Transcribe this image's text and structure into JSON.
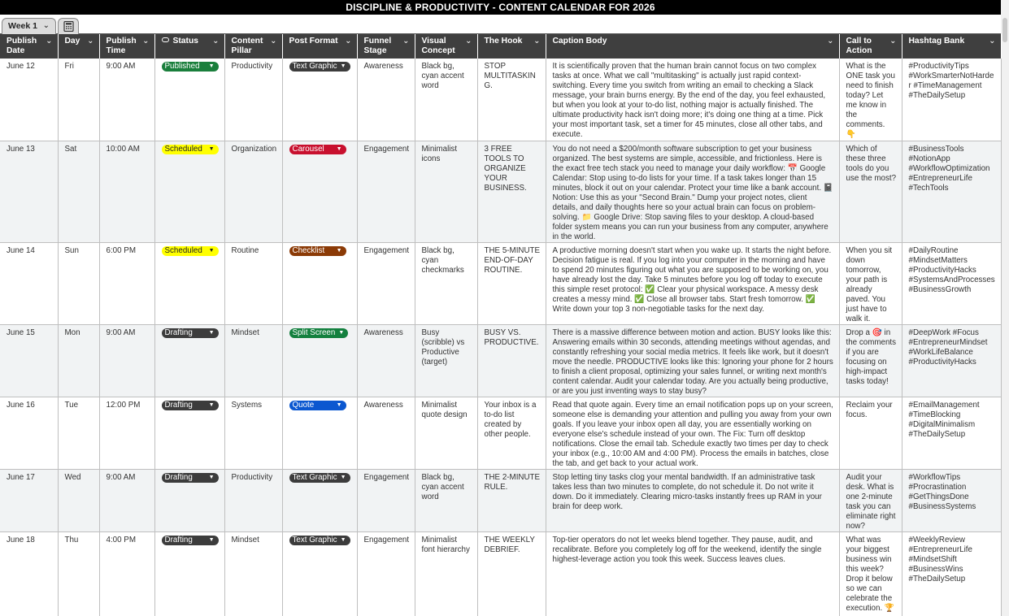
{
  "banner_title": "DISCIPLINE & PRODUCTIVITY - CONTENT CALENDAR FOR 2026",
  "tab": {
    "label": "Week 1",
    "icon": "calculator-icon"
  },
  "colors": {
    "published": "#1a7f3c",
    "scheduled": "#ffff00",
    "drafting": "#3c3c3c",
    "text_graphic": "#3c3c3c",
    "carousel": "#c8102e",
    "checklist": "#8b3a06",
    "split_screen": "#13803e",
    "quote": "#0b57d0",
    "header": "#3f3f3f"
  },
  "columns": {
    "publish_date": "Publish Date",
    "day": "Day",
    "publish_time": "Publish Time",
    "status": "Status",
    "content_pillar": "Content Pillar",
    "post_format": "Post Format",
    "funnel_stage": "Funnel Stage",
    "visual_concept": "Visual Concept",
    "hook": "The Hook",
    "caption": "Caption Body",
    "cta": "Call to Action",
    "hashtags": "Hashtag Bank"
  },
  "rows": [
    {
      "date": "June 12",
      "day": "Fri",
      "time": "9:00 AM",
      "status": "Published",
      "pillar": "Productivity",
      "format": "Text Graphic",
      "funnel": "Awareness",
      "visual": "Black bg, cyan accent word",
      "hook": "STOP MULTITASKING.",
      "caption": "It is scientifically proven that the human brain cannot focus on two complex tasks at once. What we call \"multitasking\" is actually just rapid context-switching. Every time you switch from writing an email to checking a Slack message, your brain burns energy. By the end of the day, you feel exhausted, but when you look at your to-do list, nothing major is actually finished. The ultimate productivity hack isn't doing more; it's doing one thing at a time. Pick your most important task, set a timer for 45 minutes, close all other tabs, and execute.",
      "cta": "What is the ONE task you need to finish today? Let me know in the comments. 👇",
      "hashtags": "#ProductivityTips #WorkSmarterNotHarder #TimeManagement #TheDailySetup"
    },
    {
      "date": "June 13",
      "day": "Sat",
      "time": "10:00 AM",
      "status": "Scheduled",
      "pillar": "Organization",
      "format": "Carousel",
      "funnel": "Engagement",
      "visual": "Minimalist icons",
      "hook": "3 FREE TOOLS TO ORGANIZE YOUR BUSINESS.",
      "caption": "You do not need a $200/month software subscription to get your business organized. The best systems are simple, accessible, and frictionless. Here is the exact free tech stack you need to manage your daily workflow: 📅 Google Calendar: Stop using to-do lists for your time. If a task takes longer than 15 minutes, block it out on your calendar. Protect your time like a bank account. 📓 Notion: Use this as your \"Second Brain.\" Dump your project notes, client details, and daily thoughts here so your actual brain can focus on problem-solving. 📁 Google Drive: Stop saving files to your desktop. A cloud-based folder system means you can run your business from any computer, anywhere in the world.",
      "cta": "Which of these three tools do you use the most?",
      "hashtags": "#BusinessTools #NotionApp #WorkflowOptimization #EntrepreneurLife #TechTools"
    },
    {
      "date": "June 14",
      "day": "Sun",
      "time": "6:00 PM",
      "status": "Scheduled",
      "pillar": "Routine",
      "format": "Checklist",
      "funnel": "Engagement",
      "visual": "Black bg, cyan checkmarks",
      "hook": "THE 5-MINUTE END-OF-DAY ROUTINE.",
      "caption": "A productive morning doesn't start when you wake up. It starts the night before. Decision fatigue is real. If you log into your computer in the morning and have to spend 20 minutes figuring out what you are supposed to be working on, you have already lost the day. Take 5 minutes before you log off today to execute this simple reset protocol: ✅ Clear your physical workspace. A messy desk creates a messy mind. ✅ Close all browser tabs. Start fresh tomorrow. ✅ Write down your top 3 non-negotiable tasks for the next day.",
      "cta": "When you sit down tomorrow, your path is already paved. You just have to walk it.",
      "hashtags": "#DailyRoutine #MindsetMatters #ProductivityHacks #SystemsAndProcesses #BusinessGrowth"
    },
    {
      "date": "June 15",
      "day": "Mon",
      "time": "9:00 AM",
      "status": "Drafting",
      "pillar": "Mindset",
      "format": "Split Screen",
      "funnel": "Awareness",
      "visual": "Busy (scribble) vs Productive (target)",
      "hook": "BUSY VS. PRODUCTIVE.",
      "caption": "There is a massive difference between motion and action. BUSY looks like this: Answering emails within 30 seconds, attending meetings without agendas, and constantly refreshing your social media metrics. It feels like work, but it doesn't move the needle. PRODUCTIVE looks like this: Ignoring your phone for 2 hours to finish a client proposal, optimizing your sales funnel, or writing next month's content calendar. Audit your calendar today. Are you actually being productive, or are you just inventing ways to stay busy?",
      "cta": "Drop a 🎯 in the comments if you are focusing on high-impact tasks today!",
      "hashtags": "#DeepWork #Focus #EntrepreneurMindset #WorkLifeBalance #ProductivityHacks"
    },
    {
      "date": "June 16",
      "day": "Tue",
      "time": "12:00 PM",
      "status": "Drafting",
      "pillar": "Systems",
      "format": "Quote",
      "funnel": "Awareness",
      "visual": "Minimalist quote design",
      "hook": "Your inbox is a to-do list created by other people.",
      "caption": "Read that quote again. Every time an email notification pops up on your screen, someone else is demanding your attention and pulling you away from your own goals. If you leave your inbox open all day, you are essentially working on everyone else's schedule instead of your own. The Fix: Turn off desktop notifications. Close the email tab. Schedule exactly two times per day to check your inbox (e.g., 10:00 AM and 4:00 PM). Process the emails in batches, close the tab, and get back to your actual work.",
      "cta": "Reclaim your focus.",
      "hashtags": "#EmailManagement #TimeBlocking #DigitalMinimalism #TheDailySetup"
    },
    {
      "date": "June 17",
      "day": "Wed",
      "time": "9:00 AM",
      "status": "Drafting",
      "pillar": "Productivity",
      "format": "Text Graphic",
      "funnel": "Engagement",
      "visual": "Black bg, cyan accent word",
      "hook": "THE 2-MINUTE RULE.",
      "caption": "Stop letting tiny tasks clog your mental bandwidth. If an administrative task takes less than two minutes to complete, do not schedule it. Do not write it down. Do it immediately. Clearing micro-tasks instantly frees up RAM in your brain for deep work.",
      "cta": "Audit your desk. What is one 2-minute task you can eliminate right now?",
      "hashtags": "#WorkflowTips #Procrastination #GetThingsDone #BusinessSystems"
    },
    {
      "date": "June 18",
      "day": "Thu",
      "time": "4:00 PM",
      "status": "Drafting",
      "pillar": "Mindset",
      "format": "Text Graphic",
      "funnel": "Engagement",
      "visual": "Minimalist font hierarchy",
      "hook": "THE WEEKLY DEBRIEF.",
      "caption": "Top-tier operators do not let weeks blend together. They pause, audit, and recalibrate. Before you completely log off for the weekend, identify the single highest-leverage action you took this week. Success leaves clues.",
      "cta": "What was your biggest business win this week? Drop it below so we can celebrate the execution. 🏆",
      "hashtags": "#WeeklyReview #EntrepreneurLife #MindsetShift #BusinessWins #TheDailySetup"
    }
  ]
}
